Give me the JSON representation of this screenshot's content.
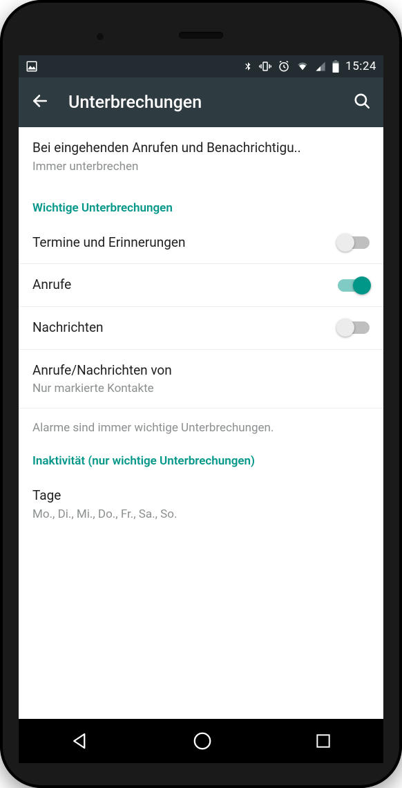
{
  "statusbar": {
    "time": "15:24"
  },
  "appbar": {
    "title": "Unterbrechungen"
  },
  "incoming": {
    "title": "Bei eingehenden Anrufen und Benachrichtigu..",
    "subtitle": "Immer unterbrechen"
  },
  "section1": {
    "header": "Wichtige Unterbrechungen",
    "items": [
      {
        "label": "Termine und Erinnerungen",
        "on": false
      },
      {
        "label": "Anrufe",
        "on": true
      },
      {
        "label": "Nachrichten",
        "on": false
      }
    ],
    "from": {
      "title": "Anrufe/Nachrichten von",
      "subtitle": "Nur markierte Kontakte"
    },
    "note": "Alarme sind immer wichtige Unterbrechungen."
  },
  "section2": {
    "header": "Inaktivität (nur wichtige Unterbrechungen)",
    "days": {
      "title": "Tage",
      "subtitle": "Mo., Di., Mi., Do., Fr., Sa., So."
    }
  }
}
